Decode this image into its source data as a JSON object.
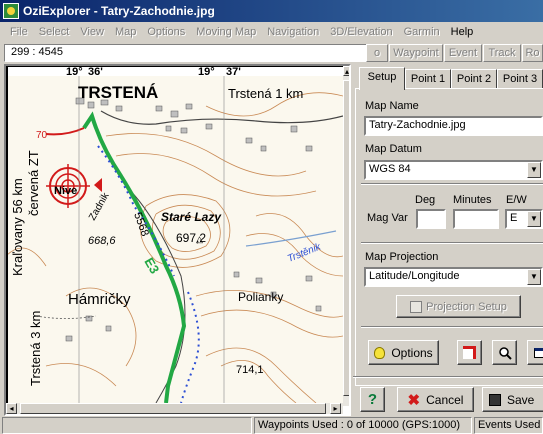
{
  "window": {
    "title": "OziExplorer - Tatry-Zachodnie.jpg"
  },
  "menu": [
    {
      "label": "File",
      "active": false
    },
    {
      "label": "Select",
      "active": false
    },
    {
      "label": "View",
      "active": false
    },
    {
      "label": "Map",
      "active": false
    },
    {
      "label": "Options",
      "active": false
    },
    {
      "label": "Moving Map",
      "active": false
    },
    {
      "label": "Navigation",
      "active": false
    },
    {
      "label": "3D/Elevation",
      "active": false
    },
    {
      "label": "Garmin",
      "active": false
    },
    {
      "label": "Help",
      "active": true
    }
  ],
  "toolbar": {
    "coordinates": "299 : 4545",
    "buttons": [
      "o",
      "Waypoint",
      "Event",
      "Track",
      "Ro"
    ]
  },
  "map": {
    "grid_labels": {
      "lon1_deg": "19°",
      "lon1_min": "36'",
      "lon2_deg": "19°",
      "lon2_min": "37'"
    },
    "place_names": {
      "trstena_big": "TRSTENÁ",
      "trstena_km": "Trstená 1 km",
      "kralovany": "Kraľovany 56 km",
      "cervena": "červená ZT",
      "trstena_side": "Trstená 3 km",
      "nive": "Nive",
      "zadnik": "Zadnik",
      "stare_lazy": "Staré Lazy",
      "elev_697": "697,2",
      "elev_668": "668,6",
      "road_5568": "5568",
      "route_e3": "E3",
      "hamricky": "Hámričky",
      "polianky": "Polianky",
      "trstenik": "Trstěnik",
      "elev_714": "714,1",
      "elev_70": "70"
    }
  },
  "panel": {
    "tabs": [
      "Setup",
      "Point 1",
      "Point 2",
      "Point 3"
    ],
    "map_name_label": "Map Name",
    "map_name_value": "Tatry-Zachodnie.jpg",
    "map_datum_label": "Map Datum",
    "map_datum_value": "WGS 84",
    "deg_label": "Deg",
    "minutes_label": "Minutes",
    "ew_label": "E/W",
    "magvar_label": "Mag Var",
    "ew_value": "E",
    "map_projection_label": "Map Projection",
    "map_projection_value": "Latitude/Longitude",
    "projection_setup_label": "Projection Setup",
    "options_label": "Options",
    "help_label": "?",
    "cancel_label": "Cancel",
    "save_label": "Save"
  },
  "status": {
    "waypoints": "Waypoints Used : 0 of 10000  (GPS:1000)",
    "events": "Events Used"
  },
  "colors": {
    "title_gradient_start": "#0a246a",
    "route_green": "#22a844",
    "contour": "#c98a55",
    "target_red": "#d21a1a",
    "blue_dots": "#2d4fd4"
  }
}
